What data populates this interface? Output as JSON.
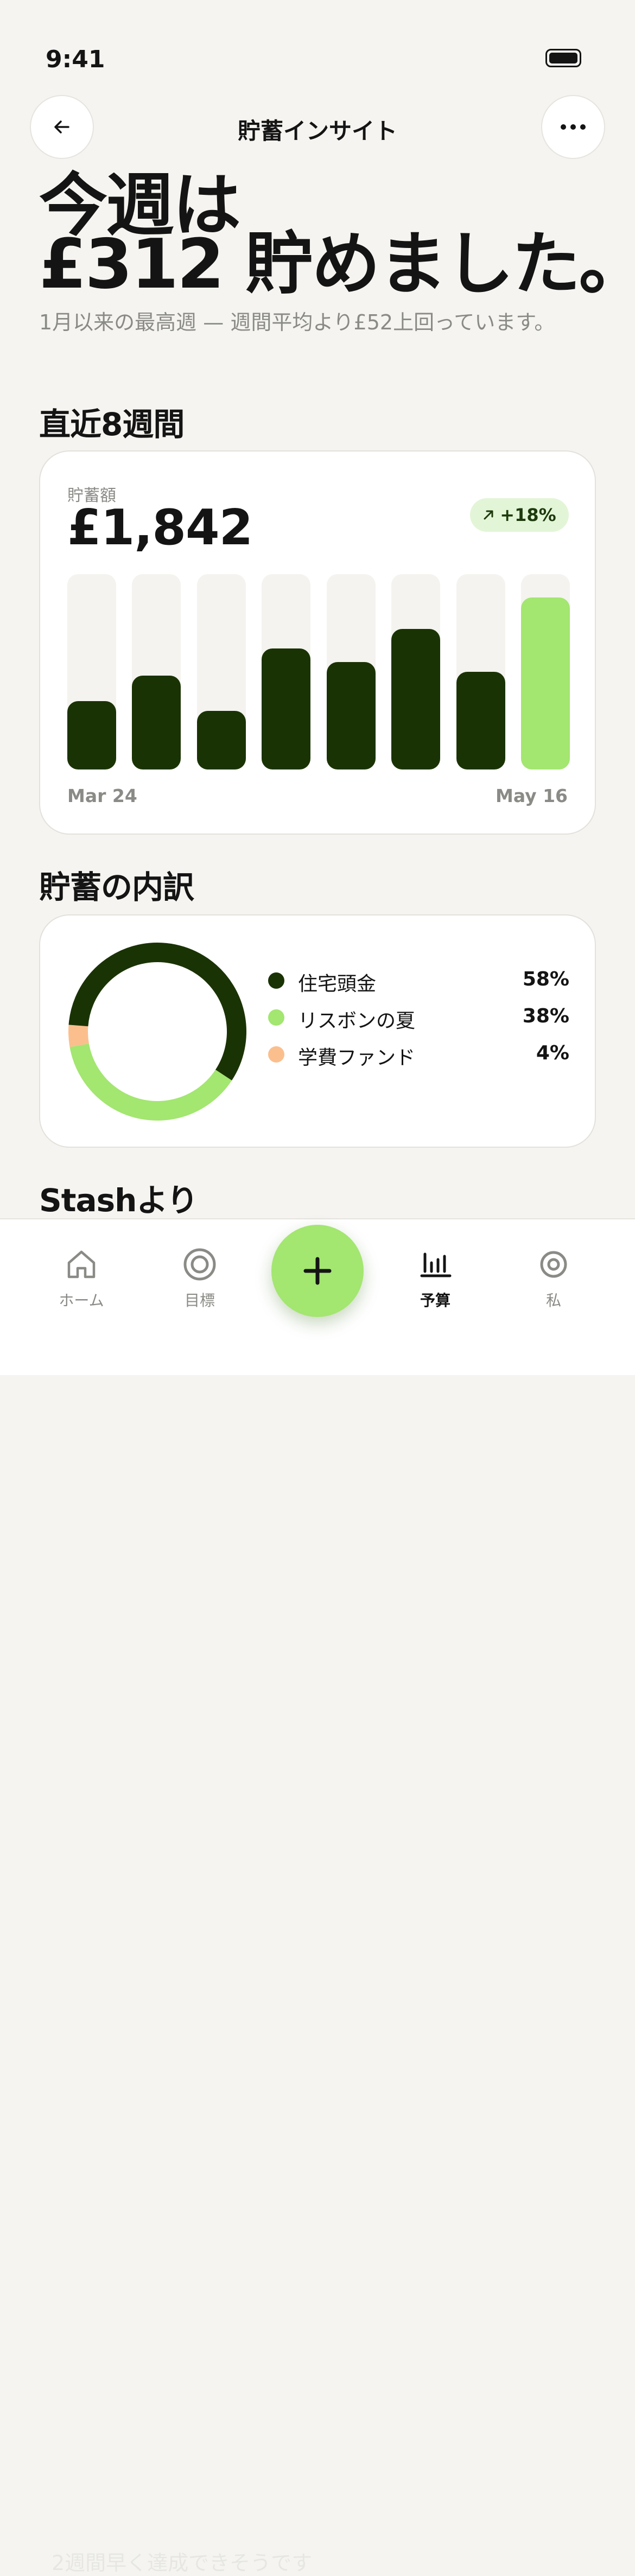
{
  "status": {
    "time": "9:41"
  },
  "header": {
    "title": "貯蓄インサイト"
  },
  "hero": {
    "line1": "今週は",
    "line2": "£312 貯めました。",
    "subtitle": "1月以来の最高週 — 週間平均より£52上回っています。"
  },
  "weekly": {
    "section_title": "直近8週間",
    "label": "貯蓄額",
    "total": "£1,842",
    "change": "+18%",
    "x_start": "Mar 24",
    "x_end": "May 16"
  },
  "chart_data": {
    "type": "bar",
    "categories": [
      "Mar 24",
      "",
      "",
      "",
      "",
      "",
      "",
      "May 16"
    ],
    "values": [
      0.35,
      0.48,
      0.3,
      0.62,
      0.55,
      0.72,
      0.5,
      0.88
    ],
    "ylim": [
      0,
      1
    ],
    "highlight_index": 7,
    "colors": {
      "normal": "#1a3304",
      "highlight": "#a3e670",
      "track": "#f4f3ef"
    }
  },
  "breakdown": {
    "section_title": "貯蓄の内訳",
    "items": [
      {
        "name": "住宅頭金",
        "pct": "58%",
        "value": 58,
        "color": "#1a3304"
      },
      {
        "name": "リスボンの夏",
        "pct": "38%",
        "value": 38,
        "color": "#a3e670"
      },
      {
        "name": "学費ファンド",
        "pct": "4%",
        "value": 4,
        "color": "#fbbf8e"
      }
    ]
  },
  "tips": {
    "section_title": "Stashより",
    "first_tip": "2週間早く達成できそうです"
  },
  "tabs": [
    {
      "label": "ホーム",
      "icon": "home-icon"
    },
    {
      "label": "目標",
      "icon": "target-icon"
    },
    {
      "label": "予算",
      "icon": "bar-chart-icon",
      "active": true
    },
    {
      "label": "私",
      "icon": "profile-icon"
    }
  ],
  "fab": {
    "icon": "plus-icon"
  }
}
